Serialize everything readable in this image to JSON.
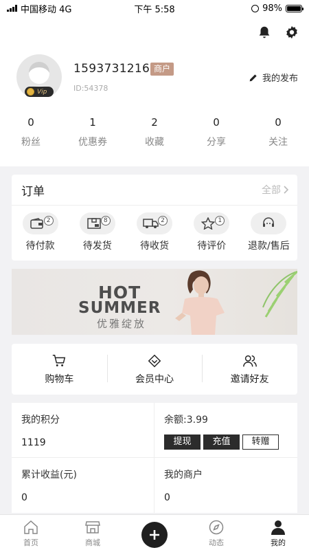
{
  "status_bar": {
    "carrier": "中国移动 4G",
    "time": "下午 5:58",
    "battery": "98%",
    "battery_level": 0.98
  },
  "profile": {
    "vip_label": "Vip",
    "phone": "15937312161",
    "role_tag": "商户",
    "user_id": "ID:54378",
    "my_posts_label": "我的发布",
    "stats": [
      {
        "value": "0",
        "label": "粉丝"
      },
      {
        "value": "1",
        "label": "优惠券"
      },
      {
        "value": "2",
        "label": "收藏"
      },
      {
        "value": "0",
        "label": "分享"
      },
      {
        "value": "0",
        "label": "关注"
      }
    ]
  },
  "orders": {
    "title": "订单",
    "view_all": "全部",
    "items": [
      {
        "label": "待付款",
        "count": "2",
        "icon": "wallet-icon"
      },
      {
        "label": "待发货",
        "count": "8",
        "icon": "package-icon"
      },
      {
        "label": "待收货",
        "count": "2",
        "icon": "truck-icon"
      },
      {
        "label": "待评价",
        "count": "1",
        "icon": "star-icon"
      },
      {
        "label": "退款/售后",
        "count": "",
        "icon": "headset-icon"
      }
    ]
  },
  "banner": {
    "line1": "HOT",
    "line2": "SUMMER",
    "subtitle": "优雅绽放"
  },
  "shortcuts": [
    {
      "label": "购物车",
      "icon": "cart-icon"
    },
    {
      "label": "会员中心",
      "icon": "diamond-icon"
    },
    {
      "label": "邀请好友",
      "icon": "users-icon"
    }
  ],
  "assets": {
    "points_label": "我的积分",
    "points_value": "1119",
    "balance_label": "余额:3.99",
    "withdraw_label": "提现",
    "recharge_label": "充值",
    "transfer_label": "转赠",
    "earnings_label": "累计收益(元)",
    "earnings_value": "0",
    "merchants_label": "我的商户",
    "merchants_value": "0"
  },
  "tabbar": {
    "items": [
      {
        "label": "首页",
        "icon": "home-icon"
      },
      {
        "label": "商城",
        "icon": "store-icon"
      },
      {
        "label": "",
        "icon": "plus-icon"
      },
      {
        "label": "动态",
        "icon": "compass-icon"
      },
      {
        "label": "我的",
        "icon": "person-icon"
      }
    ],
    "active_index": 4
  }
}
